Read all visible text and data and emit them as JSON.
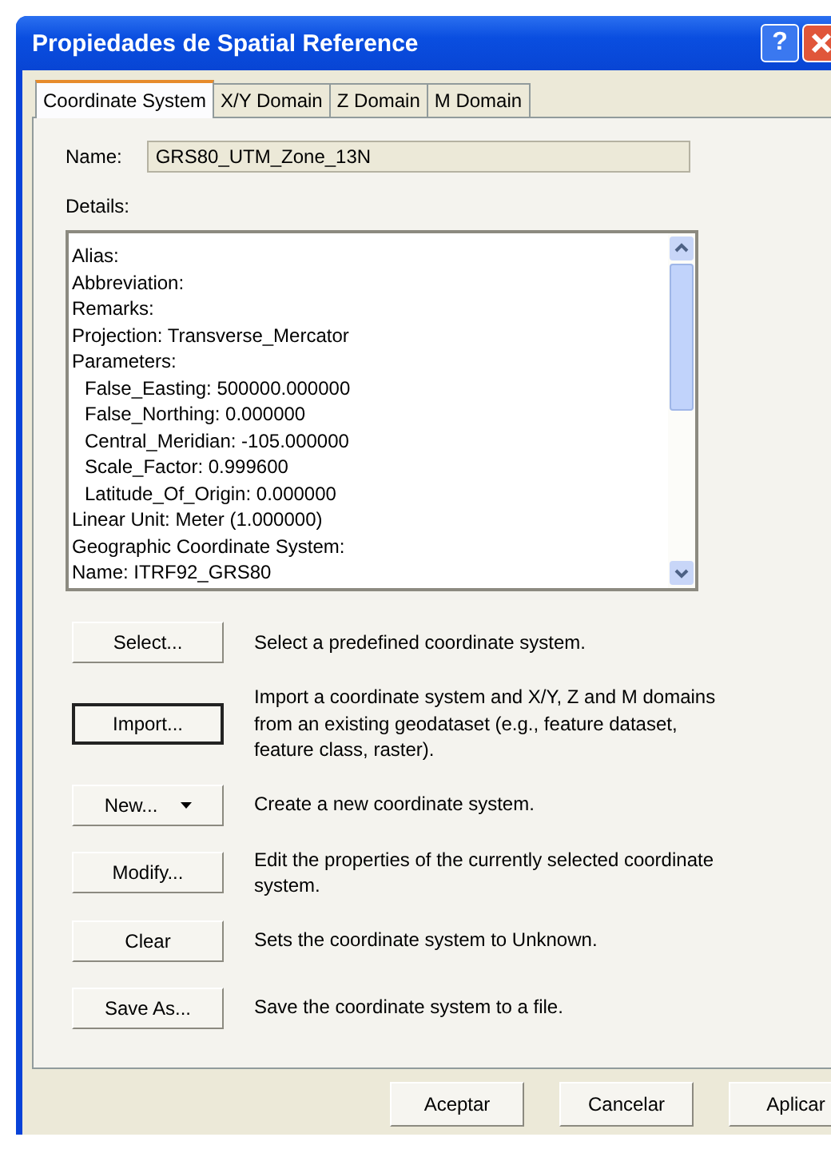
{
  "window": {
    "title": "Propiedades de Spatial Reference",
    "help_button": "?"
  },
  "tabs": [
    {
      "label": "Coordinate System",
      "selected": true
    },
    {
      "label": "X/Y Domain",
      "selected": false
    },
    {
      "label": "Z Domain",
      "selected": false
    },
    {
      "label": "M Domain",
      "selected": false
    }
  ],
  "name_field": {
    "label": "Name:",
    "value": "GRS80_UTM_Zone_13N"
  },
  "details": {
    "label": "Details:",
    "lines": [
      {
        "text": "Alias:",
        "indented": false
      },
      {
        "text": "Abbreviation:",
        "indented": false
      },
      {
        "text": "Remarks:",
        "indented": false
      },
      {
        "text": "Projection: Transverse_Mercator",
        "indented": false
      },
      {
        "text": "Parameters:",
        "indented": false
      },
      {
        "text": "False_Easting: 500000.000000",
        "indented": true
      },
      {
        "text": "False_Northing: 0.000000",
        "indented": true
      },
      {
        "text": "Central_Meridian: -105.000000",
        "indented": true
      },
      {
        "text": "Scale_Factor: 0.999600",
        "indented": true
      },
      {
        "text": "Latitude_Of_Origin: 0.000000",
        "indented": true
      },
      {
        "text": "Linear Unit: Meter (1.000000)",
        "indented": false
      },
      {
        "text": "Geographic Coordinate System:",
        "indented": false
      },
      {
        "text": "Name: ITRF92_GRS80",
        "indented": false
      }
    ]
  },
  "actions": [
    {
      "label": "Select...",
      "description": "Select a predefined coordinate system.",
      "default": false,
      "dropdown": false
    },
    {
      "label": "Import...",
      "description": "Import a coordinate system and X/Y, Z and M domains from an existing geodataset (e.g., feature dataset, feature class, raster).",
      "default": true,
      "dropdown": false
    },
    {
      "label": "New...",
      "description": "Create a new coordinate system.",
      "default": false,
      "dropdown": true
    },
    {
      "label": "Modify...",
      "description": "Edit the properties of the currently selected coordinate system.",
      "default": false,
      "dropdown": false
    },
    {
      "label": "Clear",
      "description": "Sets the coordinate system to Unknown.",
      "default": false,
      "dropdown": false
    },
    {
      "label": "Save As...",
      "description": "Save the coordinate system to a file.",
      "default": false,
      "dropdown": false
    }
  ],
  "buttons": [
    "Aceptar",
    "Cancelar",
    "Aplicar"
  ]
}
